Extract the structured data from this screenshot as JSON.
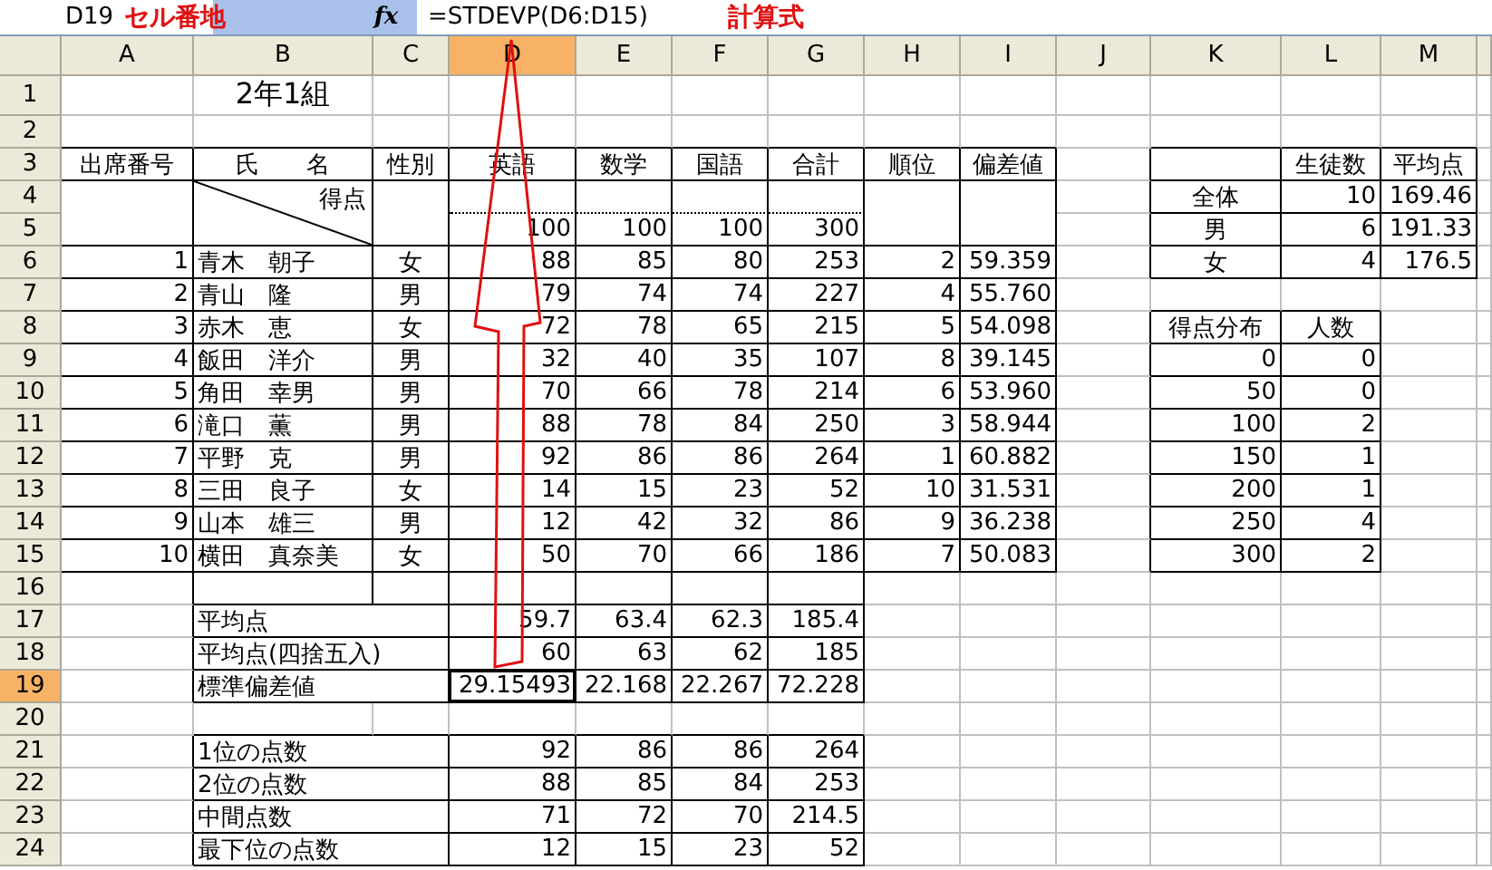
{
  "formula_bar": {
    "cell_ref": "D19",
    "cell_ref_note": "セル番地",
    "function_label": "fx",
    "formula": "=STDEVP(D6:D15)",
    "formula_note": "計算式"
  },
  "columns": [
    {
      "letter": "A",
      "selected": false
    },
    {
      "letter": "B",
      "selected": false
    },
    {
      "letter": "C",
      "selected": false
    },
    {
      "letter": "D",
      "selected": true
    },
    {
      "letter": "E",
      "selected": false
    },
    {
      "letter": "F",
      "selected": false
    },
    {
      "letter": "G",
      "selected": false
    },
    {
      "letter": "H",
      "selected": false
    },
    {
      "letter": "I",
      "selected": false
    },
    {
      "letter": "J",
      "selected": false
    },
    {
      "letter": "K",
      "selected": false
    },
    {
      "letter": "L",
      "selected": false
    },
    {
      "letter": "M",
      "selected": false
    }
  ],
  "rows": [
    {
      "number": "1",
      "selected": false,
      "cells": {
        "B": "2年1組"
      }
    },
    {
      "number": "2",
      "selected": false,
      "cells": {}
    },
    {
      "number": "3",
      "selected": false,
      "cells": {
        "A": "出席番号",
        "B": "氏　　名",
        "C": "性別",
        "D": "英語",
        "E": "数学",
        "F": "国語",
        "G": "合計",
        "H": "順位",
        "I": "偏差値",
        "L": "生徒数",
        "M": "平均点"
      }
    },
    {
      "number": "4",
      "selected": false,
      "cells": {
        "B": "得点",
        "K": "全体",
        "L": "10",
        "M": "169.46"
      }
    },
    {
      "number": "5",
      "selected": false,
      "cells": {
        "D": "100",
        "E": "100",
        "F": "100",
        "G": "300",
        "K": "男",
        "L": "6",
        "M": "191.33"
      }
    },
    {
      "number": "6",
      "selected": false,
      "cells": {
        "A": "1",
        "B": "青木　朝子",
        "C": "女",
        "D": "88",
        "E": "85",
        "F": "80",
        "G": "253",
        "H": "2",
        "I": "59.359",
        "K": "女",
        "L": "4",
        "M": "176.5"
      }
    },
    {
      "number": "7",
      "selected": false,
      "cells": {
        "A": "2",
        "B": "青山　隆",
        "C": "男",
        "D": "79",
        "E": "74",
        "F": "74",
        "G": "227",
        "H": "4",
        "I": "55.760"
      }
    },
    {
      "number": "8",
      "selected": false,
      "cells": {
        "A": "3",
        "B": "赤木　恵",
        "C": "女",
        "D": "72",
        "E": "78",
        "F": "65",
        "G": "215",
        "H": "5",
        "I": "54.098",
        "K": "得点分布",
        "L": "人数"
      }
    },
    {
      "number": "9",
      "selected": false,
      "cells": {
        "A": "4",
        "B": "飯田　洋介",
        "C": "男",
        "D": "32",
        "E": "40",
        "F": "35",
        "G": "107",
        "H": "8",
        "I": "39.145",
        "K": "0",
        "L": "0"
      }
    },
    {
      "number": "10",
      "selected": false,
      "cells": {
        "A": "5",
        "B": "角田　幸男",
        "C": "男",
        "D": "70",
        "E": "66",
        "F": "78",
        "G": "214",
        "H": "6",
        "I": "53.960",
        "K": "50",
        "L": "0"
      }
    },
    {
      "number": "11",
      "selected": false,
      "cells": {
        "A": "6",
        "B": "滝口　薫",
        "C": "男",
        "D": "88",
        "E": "78",
        "F": "84",
        "G": "250",
        "H": "3",
        "I": "58.944",
        "K": "100",
        "L": "2"
      }
    },
    {
      "number": "12",
      "selected": false,
      "cells": {
        "A": "7",
        "B": "平野　克",
        "C": "男",
        "D": "92",
        "E": "86",
        "F": "86",
        "G": "264",
        "H": "1",
        "I": "60.882",
        "K": "150",
        "L": "1"
      }
    },
    {
      "number": "13",
      "selected": false,
      "cells": {
        "A": "8",
        "B": "三田　良子",
        "C": "女",
        "D": "14",
        "E": "15",
        "F": "23",
        "G": "52",
        "H": "10",
        "I": "31.531",
        "K": "200",
        "L": "1"
      }
    },
    {
      "number": "14",
      "selected": false,
      "cells": {
        "A": "9",
        "B": "山本　雄三",
        "C": "男",
        "D": "12",
        "E": "42",
        "F": "32",
        "G": "86",
        "H": "9",
        "I": "36.238",
        "K": "250",
        "L": "4"
      }
    },
    {
      "number": "15",
      "selected": false,
      "cells": {
        "A": "10",
        "B": "横田　真奈美",
        "C": "女",
        "D": "50",
        "E": "70",
        "F": "66",
        "G": "186",
        "H": "7",
        "I": "50.083",
        "K": "300",
        "L": "2"
      }
    },
    {
      "number": "16",
      "selected": false,
      "cells": {}
    },
    {
      "number": "17",
      "selected": false,
      "cells": {
        "B": "平均点",
        "D": "59.7",
        "E": "63.4",
        "F": "62.3",
        "G": "185.4"
      }
    },
    {
      "number": "18",
      "selected": false,
      "cells": {
        "B": "平均点(四捨五入)",
        "D": "60",
        "E": "63",
        "F": "62",
        "G": "185"
      }
    },
    {
      "number": "19",
      "selected": true,
      "cells": {
        "B": "標準偏差値",
        "D": "29.15493",
        "E": "22.168",
        "F": "22.267",
        "G": "72.228"
      }
    },
    {
      "number": "20",
      "selected": false,
      "cells": {}
    },
    {
      "number": "21",
      "selected": false,
      "cells": {
        "B": "1位の点数",
        "D": "92",
        "E": "86",
        "F": "86",
        "G": "264"
      }
    },
    {
      "number": "22",
      "selected": false,
      "cells": {
        "B": "2位の点数",
        "D": "88",
        "E": "85",
        "F": "84",
        "G": "253"
      }
    },
    {
      "number": "23",
      "selected": false,
      "cells": {
        "B": "中間点数",
        "D": "71",
        "E": "72",
        "F": "70",
        "G": "214.5"
      }
    },
    {
      "number": "24",
      "selected": false,
      "cells": {
        "B": "最下位の点数",
        "D": "12",
        "E": "15",
        "F": "23",
        "G": "52"
      }
    }
  ]
}
